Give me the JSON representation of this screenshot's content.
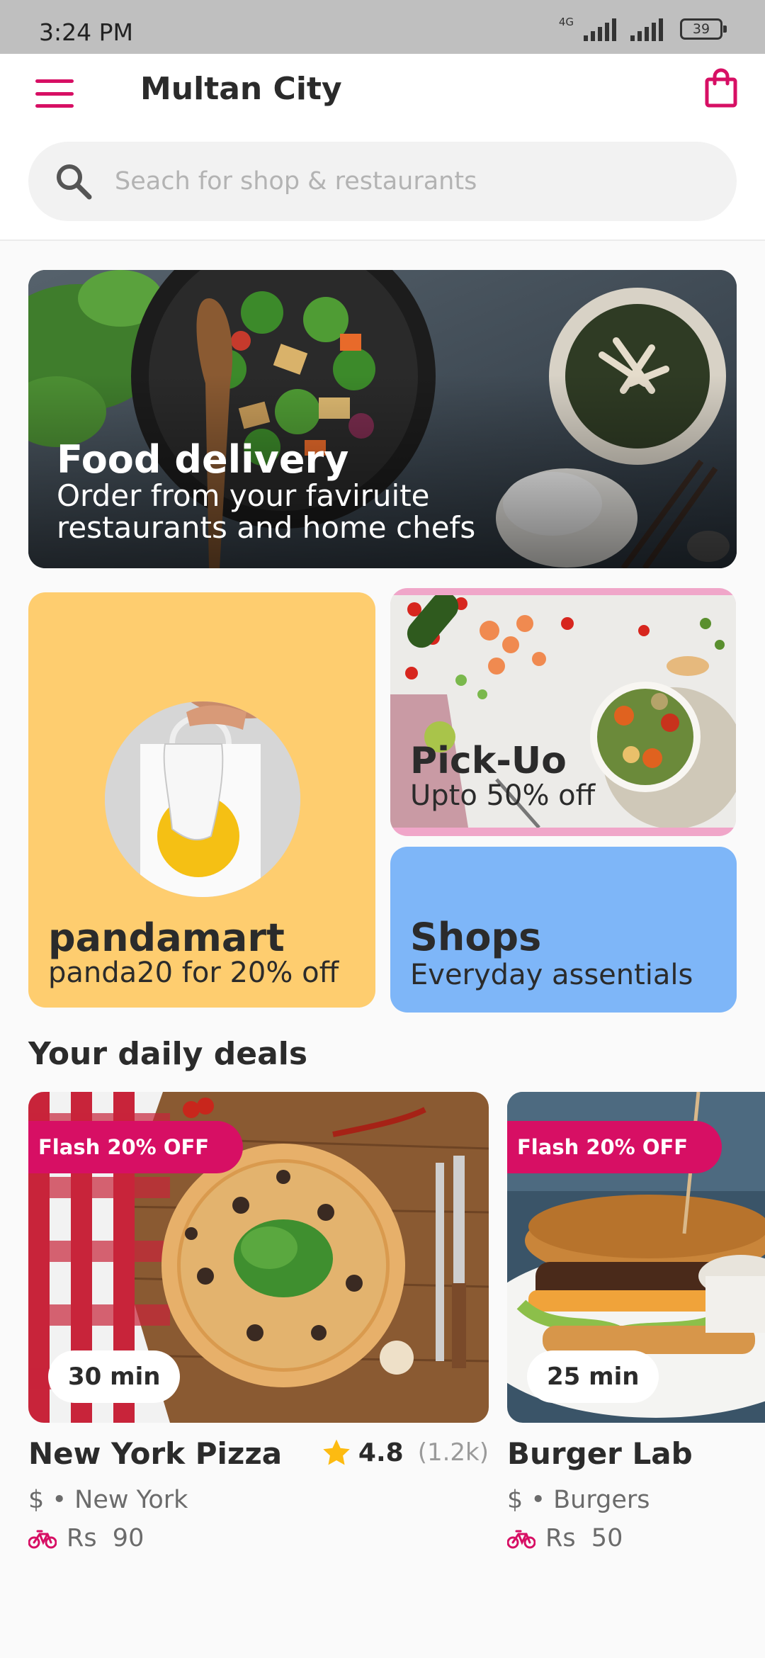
{
  "status_bar": {
    "time": "3:24 PM",
    "network": "4G",
    "battery": "39"
  },
  "header": {
    "city": "Multan City"
  },
  "search": {
    "placeholder": "Seach for shop & restaurants"
  },
  "banner": {
    "title": "Food delivery",
    "subtitle": "Order from your faviruite restaurants and home chefs"
  },
  "tiles": {
    "pandamart": {
      "title": "pandamart",
      "subtitle": "panda20 for 20% off"
    },
    "pickup": {
      "title": "Pick-Uo",
      "subtitle": "Upto 50% off"
    },
    "shops": {
      "title": "Shops",
      "subtitle": "Everyday assentials"
    }
  },
  "deals": {
    "section_title": "Your daily deals",
    "items": [
      {
        "flash": "Flash 20% OFF",
        "time": "30 min",
        "name": "New York Pizza",
        "rating": "4.8",
        "rating_count": "(1.2k)",
        "meta": "$ • New York",
        "fee": "Rs  90"
      },
      {
        "flash": "Flash 20% OFF",
        "time": "25 min",
        "name": "Burger Lab",
        "meta": "$ • Burgers",
        "fee": "Rs  50"
      }
    ]
  },
  "colors": {
    "brand": "#d70f64",
    "pandamart_bg": "#fecd6f",
    "shops_bg": "#7eb6f8",
    "pickup_border": "#f0a6c9",
    "star": "#fdbb11"
  },
  "icons": [
    "menu-icon",
    "shopping-bag-icon",
    "search-icon",
    "star-icon",
    "bicycle-icon"
  ]
}
